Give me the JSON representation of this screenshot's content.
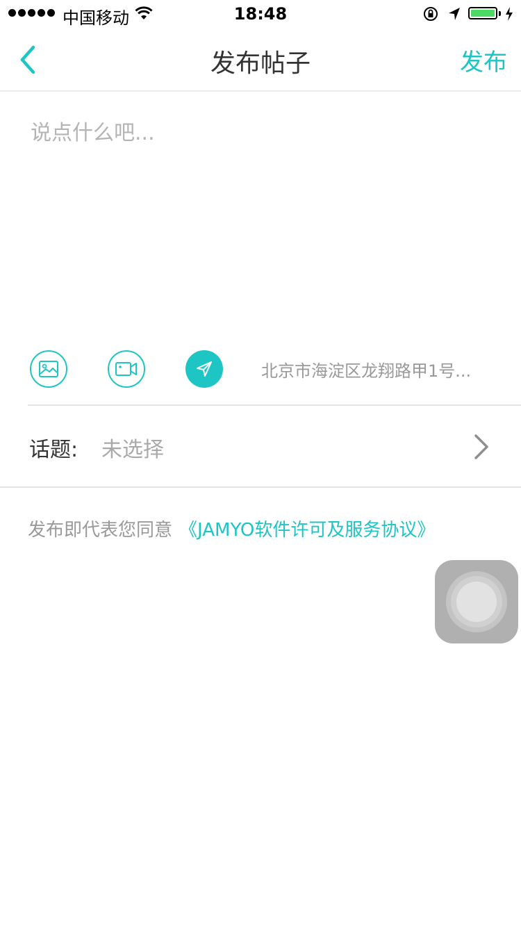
{
  "status_bar": {
    "carrier": "中国移动",
    "time": "18:48",
    "battery_color": "#4cd964"
  },
  "nav": {
    "title": "发布帖子",
    "publish_label": "发布",
    "back_icon": "chevron-left-icon"
  },
  "editor": {
    "placeholder": "说点什么吧...",
    "value": ""
  },
  "toolbar": {
    "image_icon": "image-icon",
    "video_icon": "video-camera-icon",
    "location_icon": "location-arrow-icon",
    "location_text": "北京市海淀区龙翔路甲1号..."
  },
  "topic": {
    "label": "话题:",
    "value": "未选择"
  },
  "agreement": {
    "prefix": "发布即代表您同意",
    "link": "《JAMYO软件许可及服务协议》"
  },
  "colors": {
    "accent": "#1ec5c5",
    "placeholder": "#b4b4b4",
    "secondary_text": "#999999"
  }
}
